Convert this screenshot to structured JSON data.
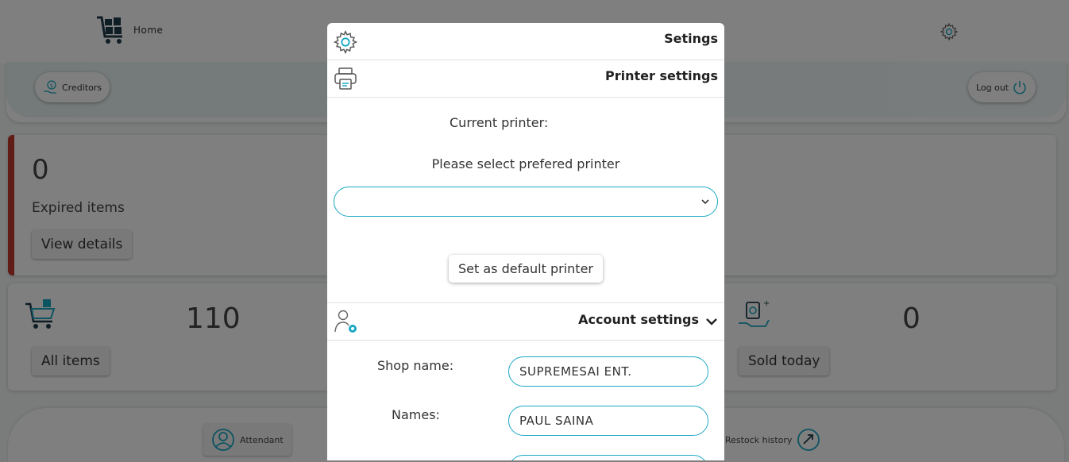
{
  "nav": {
    "home_label": "Home",
    "creditors_label": "Creditors",
    "logout_label": "Log out"
  },
  "cards": {
    "expired": {
      "count": "0",
      "label": "Expired items",
      "button": "View details"
    },
    "all_items": {
      "count": "110",
      "button": "All items"
    },
    "sold_today": {
      "count": "0",
      "button": "Sold today"
    }
  },
  "bottom_nav": {
    "attendant_label": "Attendant",
    "restock_label": "Restock history"
  },
  "modal": {
    "title": "Setings",
    "printer": {
      "title": "Printer settings",
      "current_label": "Current printer:",
      "select_prompt": "Please select prefered printer",
      "selected_value": "",
      "default_button": "Set as default printer"
    },
    "account": {
      "title": "Account settings",
      "shop_name_label": "Shop name:",
      "shop_name_value": "SUPREMESAI ENT.",
      "names_label": "Names:",
      "names_value": "PAUL SAINA"
    }
  },
  "colors": {
    "accent": "#1ba8c3",
    "alert": "#c0392b",
    "overlay": "rgba(0,0,0,0.5)"
  },
  "icons": [
    "cart-icon",
    "gear-icon",
    "money-hand-icon",
    "power-icon",
    "printer-icon",
    "user-gear-icon",
    "chevron-down-icon",
    "person-icon",
    "restock-icon",
    "basket-icon",
    "shopping-bag-hand-icon"
  ]
}
